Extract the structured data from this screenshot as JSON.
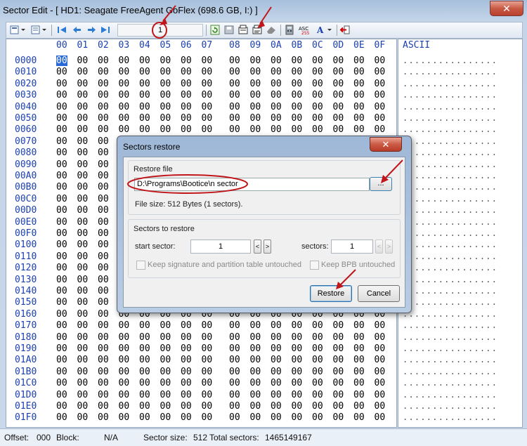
{
  "window": {
    "title": "Sector Edit - [ HD1: Seagate FreeAgent GoFlex (698.6 GB, I:) ]",
    "close_glyph": "✕"
  },
  "toolbar": {
    "sector_value": "1",
    "buttons": [
      "view-icon",
      "list-icon",
      "first-icon",
      "prev-icon",
      "next-icon",
      "last-icon",
      "refresh-icon",
      "save-icon",
      "backup-icon",
      "restore-icon",
      "erase-icon",
      "calculator-icon",
      "code-page-icon",
      "font-icon",
      "exit-icon"
    ]
  },
  "editor": {
    "columns": [
      "00",
      "01",
      "02",
      "03",
      "04",
      "05",
      "06",
      "07",
      "08",
      "09",
      "0A",
      "0B",
      "0C",
      "0D",
      "0E",
      "0F"
    ],
    "ascii_header": "ASCII",
    "rows": [
      "0000",
      "0010",
      "0020",
      "0030",
      "0040",
      "0050",
      "0060",
      "0070",
      "0080",
      "0090",
      "00A0",
      "00B0",
      "00C0",
      "00D0",
      "00E0",
      "00F0",
      "0100",
      "0110",
      "0120",
      "0130",
      "0140",
      "0150",
      "0160",
      "0170",
      "0180",
      "0190",
      "01A0",
      "01B0",
      "01C0",
      "01D0",
      "01E0",
      "01F0"
    ],
    "byte_value": "00"
  },
  "dialog": {
    "title": "Sectors restore",
    "close_glyph": "✕",
    "restore_file_label": "Restore file",
    "restore_path": "D:\\Programs\\Bootice\\n sector",
    "browse_label": "...",
    "file_size_text": "File size: 512 Bytes (1 sectors).",
    "sectors_group_label": "Sectors to restore",
    "start_sector_label": "start sector:",
    "start_sector_value": "1",
    "sectors_label": "sectors:",
    "sectors_value": "1",
    "spin_prev": "<",
    "spin_next": ">",
    "keep_signature_label": "Keep signature and partition table untouched",
    "keep_bpb_label": "Keep BPB untouched",
    "restore_button": "Restore",
    "cancel_button": "Cancel"
  },
  "status": {
    "offset_label": "Offset:",
    "offset_value": "000",
    "block_label": "Block:",
    "block_value": "N/A",
    "sector_size_label": "Sector size:",
    "sector_size_value": "512",
    "total_sectors_label": "Total sectors:",
    "total_sectors_value": "1465149167"
  },
  "colors": {
    "annotation": "#c0161a",
    "address_blue": "#1a3fb0",
    "selection": "#2a6ad6"
  }
}
